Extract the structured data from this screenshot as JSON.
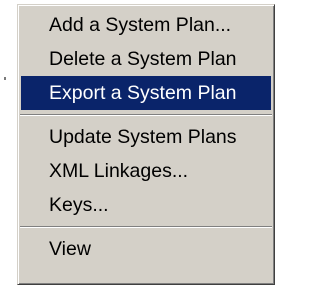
{
  "context_menu": {
    "groups": [
      {
        "items": [
          {
            "label": "Add a System Plan..."
          },
          {
            "label": "Delete a System Plan"
          },
          {
            "label": "Export a System Plan",
            "state": "highlighted"
          }
        ]
      },
      {
        "items": [
          {
            "label": "Update System Plans"
          },
          {
            "label": "XML Linkages..."
          },
          {
            "label": "Keys..."
          }
        ]
      },
      {
        "items": [
          {
            "label": "View"
          }
        ]
      }
    ],
    "colors": {
      "menu_background": "#d4d0c8",
      "highlight_background": "#0a246a",
      "highlight_text": "#ffffff",
      "text": "#000000"
    }
  }
}
